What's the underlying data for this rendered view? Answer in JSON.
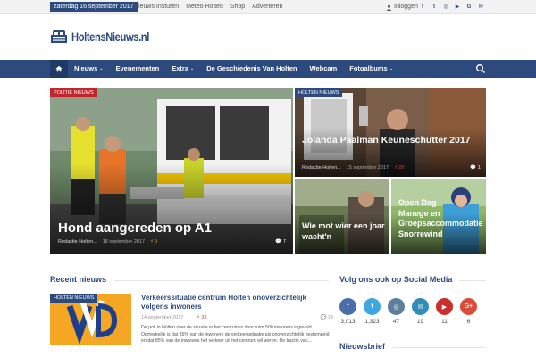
{
  "topbar": {
    "date": "zaterdag 16 september 2017",
    "links": [
      "Nieuws Insturen",
      "Meteo Holten",
      "Shop",
      "Adverteren"
    ],
    "login": "Inloggen",
    "social_icons": [
      "facebook-icon",
      "twitter-icon",
      "instagram-icon",
      "youtube-icon",
      "googleplus-icon",
      "email-icon"
    ]
  },
  "logo": {
    "text": "HoltensNieuws.nl"
  },
  "nav": {
    "items": [
      {
        "label": "Nieuws",
        "dropdown": true
      },
      {
        "label": "Evenementen",
        "dropdown": false
      },
      {
        "label": "Extra",
        "dropdown": true
      },
      {
        "label": "De Geschiedenis Van Holten",
        "dropdown": false
      },
      {
        "label": "Webcam",
        "dropdown": false
      },
      {
        "label": "Fotoalbums",
        "dropdown": true
      }
    ]
  },
  "hero": {
    "main": {
      "category": "POLITIE NIEUWS",
      "title": "Hond aangereden op A1",
      "author": "Redactie Holten...",
      "date": "18 september 2017",
      "heat": "9",
      "comments": "7"
    },
    "top_right": {
      "category": "HOLTEN NIEUWS",
      "title": "Jolanda Paalman Keuneschutter 2017",
      "author": "Redactie Holten...",
      "date": "15 september 2017",
      "heat": "28",
      "comments": "1"
    },
    "bottom_left": {
      "title": "Wie mot wier een joar wacht'n"
    },
    "bottom_right": {
      "title": "Open Dag Manege en Groepsaccommodatie Snorrewind"
    }
  },
  "recent": {
    "heading": "Recent nieuws",
    "article": {
      "category": "HOLTEN NIEUWS",
      "title": "Verkeerssituatie centrum Holten onoverzichtelijk volgens inwoners",
      "date": "14 september 2017",
      "heat": "33",
      "comments": "14",
      "excerpt": "De poll in Holten over de situatie in het centrum is door ruim 500 inwoners ingevuld. Opmerkelijk is dat 85% van de inwoners de verkeerssituatie als onoverzichtelijk bestempeld en dat 85% van de inwoners het verkeer uit het centrum wil weren. De tractie van..."
    }
  },
  "sidebar": {
    "social_heading": "Volg ons ook op Social Media",
    "socials": [
      {
        "icon": "facebook-icon",
        "glyph": "f",
        "count": "3,013",
        "color": "#4a6ea9"
      },
      {
        "icon": "twitter-icon",
        "glyph": "t",
        "count": "1,323",
        "color": "#3fa7e0"
      },
      {
        "icon": "instagram-icon",
        "glyph": "◎",
        "count": "47",
        "color": "#5d7f9e"
      },
      {
        "icon": "email-icon",
        "glyph": "✉",
        "count": "19",
        "color": "#2e8eb8"
      },
      {
        "icon": "youtube-icon",
        "glyph": "▶",
        "count": "11",
        "color": "#cc2e2b"
      },
      {
        "icon": "googleplus-icon",
        "glyph": "G+",
        "count": "6",
        "color": "#dc4a38"
      }
    ],
    "newsletter_heading": "Nieuwsbrief"
  }
}
